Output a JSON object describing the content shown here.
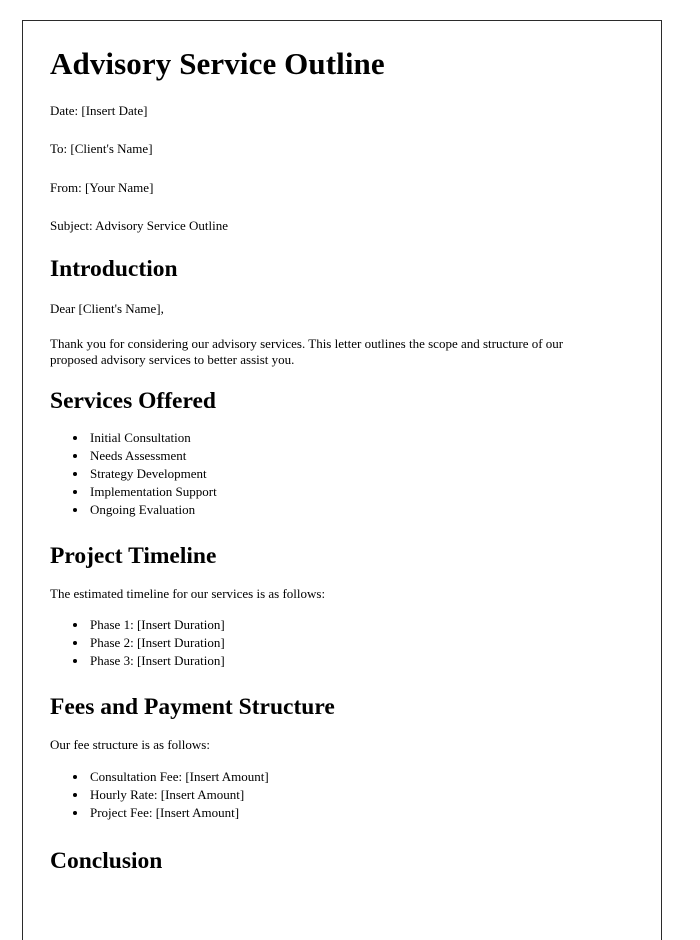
{
  "document": {
    "title": "Advisory Service Outline",
    "meta": [
      "Date: [Insert Date]",
      "To: [Client's Name]",
      "From: [Your Name]",
      "Subject: Advisory Service Outline"
    ],
    "sections": {
      "introduction": {
        "heading": "Introduction",
        "salutation": "Dear [Client's Name],",
        "paragraph": "Thank you for considering our advisory services. This letter outlines the scope and structure of our proposed advisory services to better assist you."
      },
      "services": {
        "heading": "Services Offered",
        "items": [
          "Initial Consultation",
          "Needs Assessment",
          "Strategy Development",
          "Implementation Support",
          "Ongoing Evaluation"
        ]
      },
      "timeline": {
        "heading": "Project Timeline",
        "intro": "The estimated timeline for our services is as follows:",
        "items": [
          "Phase 1: [Insert Duration]",
          "Phase 2: [Insert Duration]",
          "Phase 3: [Insert Duration]"
        ]
      },
      "fees": {
        "heading": "Fees and Payment Structure",
        "intro": "Our fee structure is as follows:",
        "items": [
          "Consultation Fee: [Insert Amount]",
          "Hourly Rate: [Insert Amount]",
          "Project Fee: [Insert Amount]"
        ]
      },
      "conclusion": {
        "heading": "Conclusion"
      }
    }
  },
  "colors": {
    "page_background": "#ffffff",
    "page_border": "#2b2b2b",
    "text": "#000000"
  }
}
